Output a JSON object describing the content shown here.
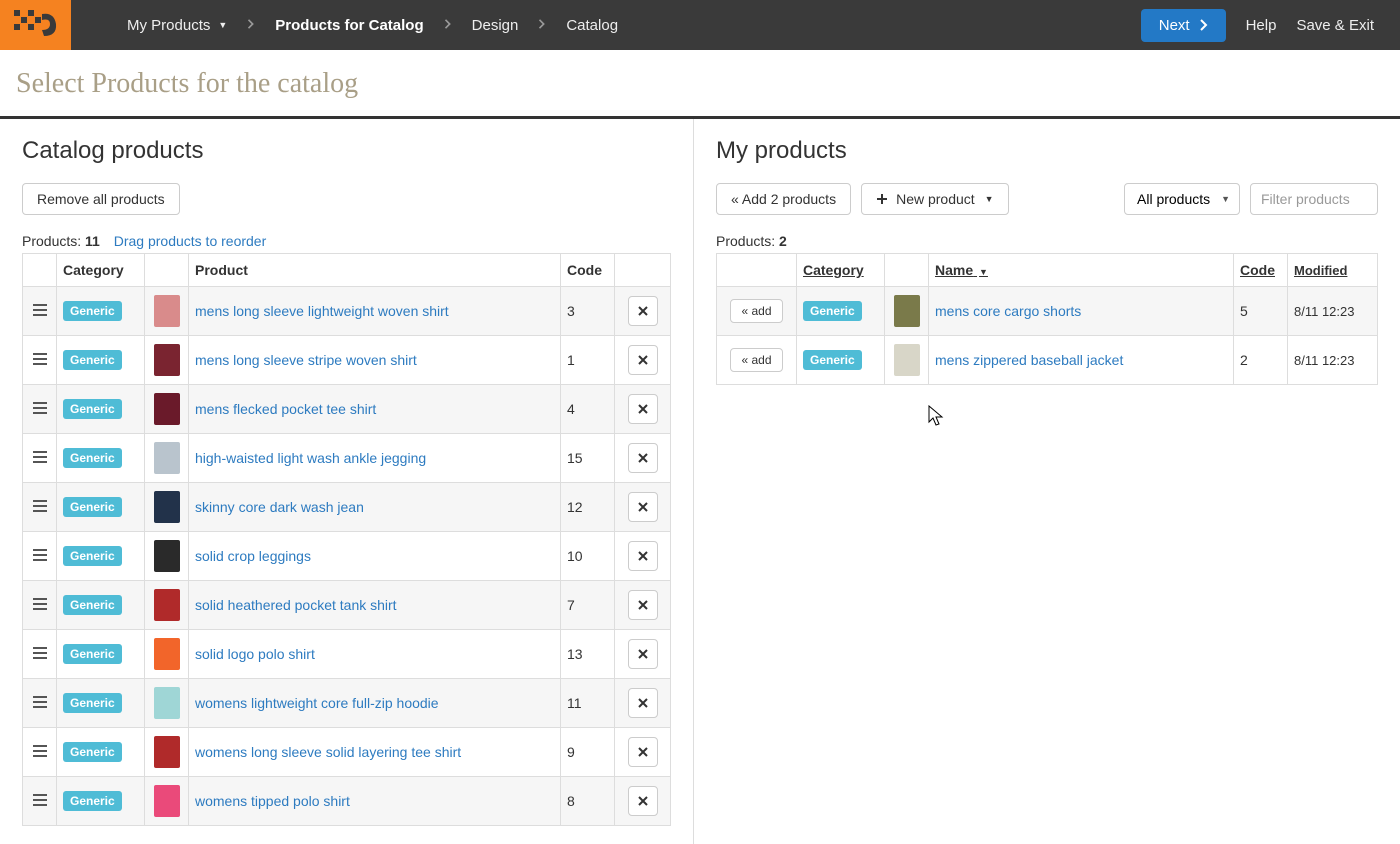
{
  "nav": {
    "items": [
      {
        "label": "My Products",
        "has_caret": true
      },
      {
        "label": "Products for Catalog",
        "active": true
      },
      {
        "label": "Design"
      },
      {
        "label": "Catalog"
      }
    ],
    "next_label": "Next",
    "help_label": "Help",
    "save_exit_label": "Save & Exit"
  },
  "page_title": "Select Products for the catalog",
  "left": {
    "heading": "Catalog products",
    "remove_all_label": "Remove all products",
    "products_label": "Products:",
    "product_count": "11",
    "hint": "Drag products to reorder",
    "cols": {
      "category": "Category",
      "product": "Product",
      "code": "Code"
    },
    "rows": [
      {
        "category": "Generic",
        "name": "mens long sleeve lightweight woven shirt",
        "code": "3",
        "color": "#d98b8b"
      },
      {
        "category": "Generic",
        "name": "mens long sleeve stripe woven shirt",
        "code": "1",
        "color": "#7a2430"
      },
      {
        "category": "Generic",
        "name": "mens flecked pocket tee shirt",
        "code": "4",
        "color": "#6a1a2a"
      },
      {
        "category": "Generic",
        "name": "high-waisted light wash ankle jegging",
        "code": "15",
        "color": "#b9c4cd"
      },
      {
        "category": "Generic",
        "name": "skinny core dark wash jean",
        "code": "12",
        "color": "#22324a"
      },
      {
        "category": "Generic",
        "name": "solid crop leggings",
        "code": "10",
        "color": "#2a2a2a"
      },
      {
        "category": "Generic",
        "name": "solid heathered pocket tank shirt",
        "code": "7",
        "color": "#b02a2a"
      },
      {
        "category": "Generic",
        "name": "solid logo polo shirt",
        "code": "13",
        "color": "#f2652a"
      },
      {
        "category": "Generic",
        "name": "womens lightweight core full-zip hoodie",
        "code": "11",
        "color": "#9fd6d6"
      },
      {
        "category": "Generic",
        "name": "womens long sleeve solid layering tee shirt",
        "code": "9",
        "color": "#b02a2a"
      },
      {
        "category": "Generic",
        "name": "womens tipped polo shirt",
        "code": "8",
        "color": "#ea4a7a"
      }
    ]
  },
  "right": {
    "heading": "My products",
    "add_btn_label": "« Add 2 products",
    "new_product_label": "New product",
    "filter_select": "All products",
    "filter_placeholder": "Filter products",
    "products_label": "Products:",
    "product_count": "2",
    "cols": {
      "category": "Category",
      "name": "Name",
      "code": "Code",
      "modified": "Modified"
    },
    "add_row_label": "« add",
    "rows": [
      {
        "category": "Generic",
        "name": "mens core cargo shorts",
        "code": "5",
        "modified": "8/11 12:23",
        "color": "#7a7a4a"
      },
      {
        "category": "Generic",
        "name": "mens zippered baseball jacket",
        "code": "2",
        "modified": "8/11 12:23",
        "color": "#d8d6c8"
      }
    ]
  }
}
